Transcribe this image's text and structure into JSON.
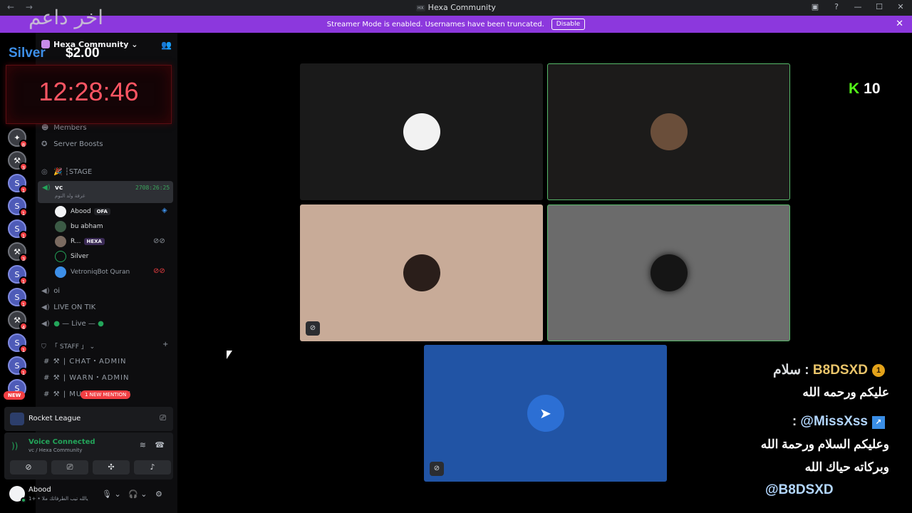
{
  "window": {
    "title": "Hexa Community",
    "title_badge": "HX"
  },
  "banner": {
    "text": "Streamer Mode is enabled. Usernames have been truncated.",
    "button": "Disable"
  },
  "server": {
    "name": "Hexa Community ⌄"
  },
  "overlays": {
    "arabic_title": "اخر داعم",
    "supporter": "Silver",
    "amount": "$2.00",
    "clock": "12:28:46",
    "kick_count": "10"
  },
  "rail": {
    "badges": [
      "8",
      "3",
      "1",
      "1",
      "1",
      "3",
      "1",
      "1",
      "4",
      "1",
      "1"
    ],
    "new_label": "NEW"
  },
  "channels": {
    "members": "Members",
    "boosts": "Server Boosts",
    "stage": "🎉 ┆STAGE",
    "vc_name": "vc",
    "vc_sub": "غرفة ولد النوم",
    "vc_time": "2708:26:25",
    "oi": "oi",
    "live_tik": "LIVE ON TIK",
    "live": "— Live —",
    "staff": "「 STAFF 」 ⌄",
    "chat_admin": "⚒ | CHAT・ADMIN",
    "warn_admin": "⚒ | WARN・ADMIN",
    "music_admin": "⚒ | MUSIC・ADMIN",
    "mention": "1 NEW MENTION"
  },
  "members": [
    {
      "name": "Abood",
      "tag": "OFA"
    },
    {
      "name": "bu abham",
      "tag": ""
    },
    {
      "name": "R...",
      "tag": "HEXA"
    },
    {
      "name": "Silver",
      "tag": ""
    },
    {
      "name": "VetroniqBot Quran",
      "tag": ""
    }
  ],
  "activity": {
    "game": "Rocket League"
  },
  "voice": {
    "status": "Voice Connected",
    "location": "vc / Hexa Community"
  },
  "user": {
    "name": "Abood",
    "status": "يالله تيب الطرفاتك ملا • +1"
  },
  "chat": {
    "user1": "B8DSXD",
    "msg1_a": "سلام",
    "msg1_b": "عليكم ورحمه الله",
    "user2": "@MissXss",
    "msg2_a": "وعليكم السلام ورحمة الله",
    "msg2_b": "وبركاته حياك الله",
    "msg2_c": "@B8DSXD"
  },
  "colors": {
    "banner": "#8c38dd",
    "voice_green": "#23a55a",
    "clock_red": "#ff5563",
    "kick_green": "#53fc18"
  }
}
